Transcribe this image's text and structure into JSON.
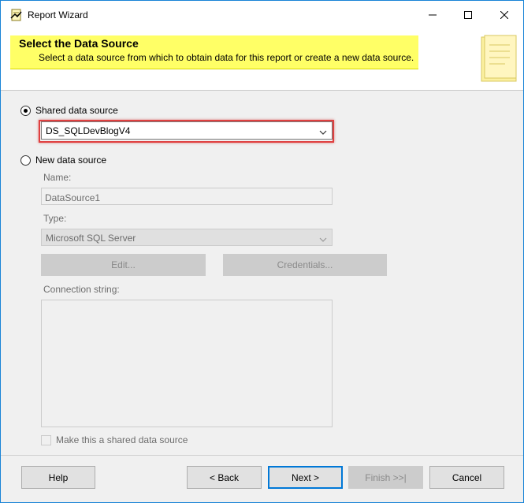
{
  "window": {
    "title": "Report Wizard",
    "icon": "report-wizard-icon"
  },
  "header": {
    "title": "Select the Data Source",
    "subtitle": "Select a data source from which to obtain data for this report or create a new data source."
  },
  "shared": {
    "label": "Shared data source",
    "selected": true,
    "value": "DS_SQLDevBlogV4"
  },
  "new_source": {
    "label": "New data source",
    "selected": false,
    "name_label": "Name:",
    "name_value": "DataSource1",
    "type_label": "Type:",
    "type_value": "Microsoft SQL Server",
    "edit_label": "Edit...",
    "credentials_label": "Credentials...",
    "connection_label": "Connection string:",
    "connection_value": "",
    "make_shared_label": "Make this a shared data source"
  },
  "footer": {
    "help": "Help",
    "back": "< Back",
    "next": "Next >",
    "finish": "Finish >>|",
    "cancel": "Cancel"
  },
  "colors": {
    "banner": "#ffff66",
    "highlight": "#e04040",
    "accent": "#0078d7"
  }
}
